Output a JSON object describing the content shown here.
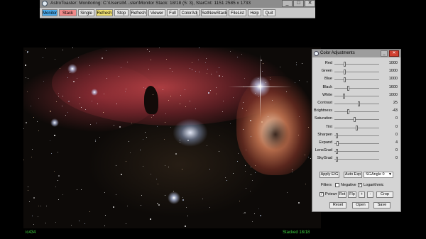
{
  "window": {
    "title": "AstroToaster: Monitoring: C:\\Users\\M...ster\\Monitor   Stack: 18/18 (5: 3), StarCnt: 1151   2585 x 1733",
    "min": "_",
    "max": "□",
    "close": "✕"
  },
  "toolbar": [
    {
      "label": "Monitor",
      "bg": "#4aa8e8"
    },
    {
      "label": "Stack",
      "bg": "#f08a8a"
    },
    {
      "label": "Single",
      "bg": "#e6e6e6"
    },
    {
      "label": "Refresh",
      "bg": "#f0e070"
    },
    {
      "label": "Stop",
      "bg": "#e6e6e6"
    },
    {
      "label": "Refresh",
      "bg": "#e6e6e6"
    },
    {
      "label": "Viewer",
      "bg": "#e6e6e6"
    },
    {
      "label": "Full",
      "bg": "#e6e6e6"
    },
    {
      "label": "ColorAdj",
      "bg": "#e6e6e6"
    },
    {
      "label": "SetNewStack",
      "bg": "#e6e6e6"
    },
    {
      "label": "FileList",
      "bg": "#e6e6e6"
    },
    {
      "label": "Help",
      "bg": "#e6e6e6"
    },
    {
      "label": "Quit",
      "bg": "#e6e6e6"
    }
  ],
  "status": {
    "left": "ic434",
    "right": "Stacked 18/18"
  },
  "panel": {
    "title": "Color Adjustments",
    "sliders": [
      {
        "label": "Red",
        "value": "1000",
        "pos": 0.22
      },
      {
        "label": "Green",
        "value": "1000",
        "pos": 0.22
      },
      {
        "label": "Blue",
        "value": "1000",
        "pos": 0.22
      },
      {
        "label": "Black",
        "value": "1600",
        "pos": 0.3
      },
      {
        "label": "White",
        "value": "1000",
        "pos": 0.2
      },
      {
        "label": "Contrast",
        "value": "25",
        "pos": 0.55
      },
      {
        "label": "Brightness",
        "value": "-43",
        "pos": 0.3
      },
      {
        "label": "Saturation",
        "value": "0",
        "pos": 0.45
      },
      {
        "label": "Tint",
        "value": "0",
        "pos": 0.5
      },
      {
        "label": "Sharpen",
        "value": "0",
        "pos": 0.04
      },
      {
        "label": "Expand",
        "value": "4",
        "pos": 0.05
      },
      {
        "label": "LensGrad",
        "value": "0",
        "pos": 0.04
      },
      {
        "label": "SkyGrad",
        "value": "0",
        "pos": 0.04
      }
    ],
    "apply_eg": "Apply E/G",
    "auto_exp": "Auto Exp",
    "sg_angle": "SGAngle 0",
    "filters_label": "Filters",
    "negative": "Negative",
    "logarithmic": "Logarithmic",
    "logarithmic_checked": true,
    "pviewer": "Pviewr",
    "pviewer_checked": true,
    "rot": "Rot",
    "flip": "Flp",
    "plus": "+",
    "minus": "-",
    "crop": "Crop",
    "reset": "Reset",
    "open": "Open",
    "save": "Save"
  }
}
